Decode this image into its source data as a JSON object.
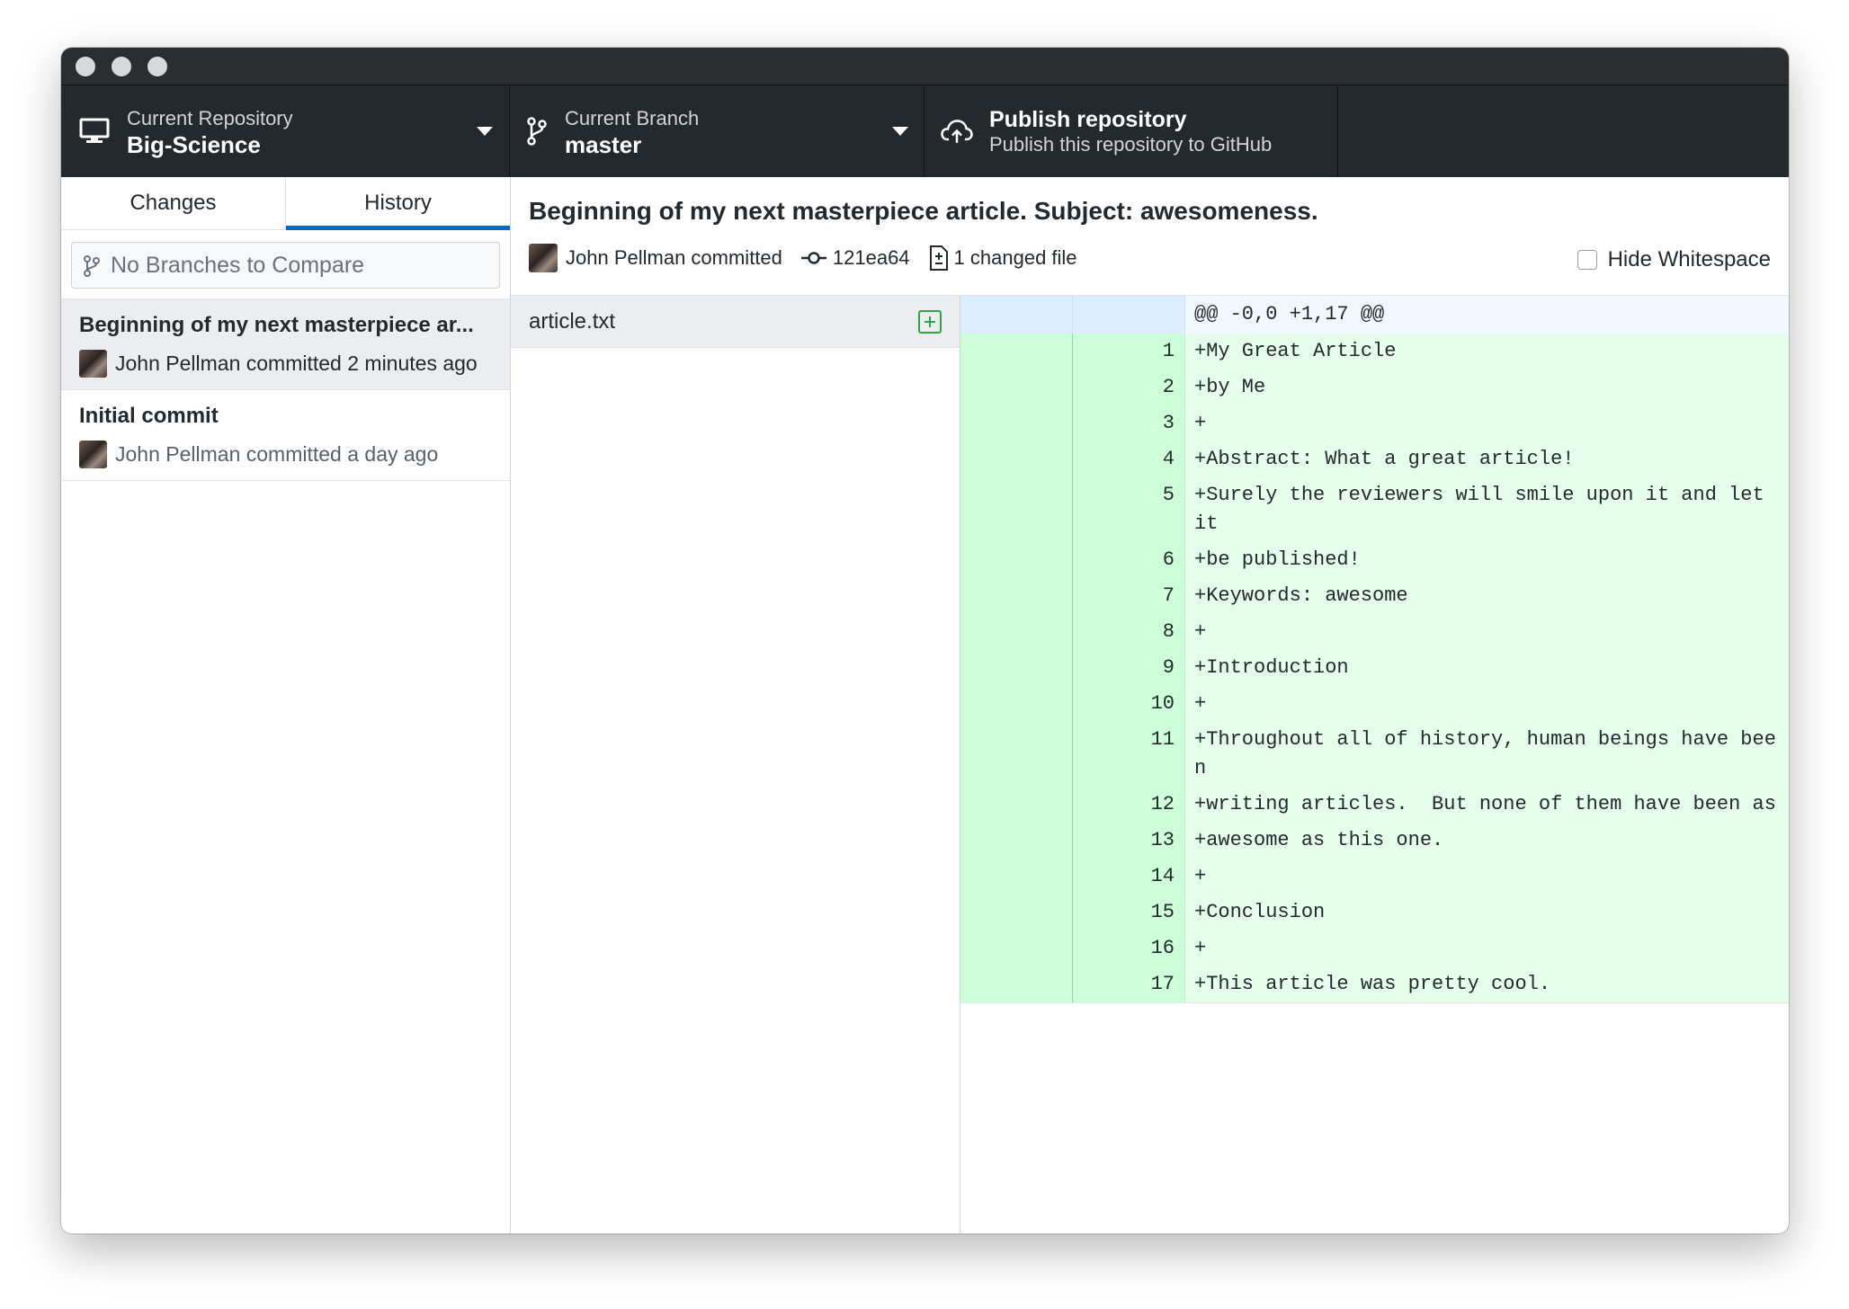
{
  "toolbar": {
    "repository": {
      "label": "Current Repository",
      "value": "Big-Science",
      "icon": "desktop-icon"
    },
    "branch": {
      "label": "Current Branch",
      "value": "master",
      "icon": "git-branch-icon"
    },
    "publish": {
      "title": "Publish repository",
      "subtitle": "Publish this repository to GitHub",
      "icon": "cloud-upload-icon"
    }
  },
  "sidebar": {
    "tabs": [
      {
        "label": "Changes"
      },
      {
        "label": "History",
        "active": true
      }
    ],
    "compare_placeholder": "No Branches to Compare",
    "commits": [
      {
        "title": "Beginning of my next masterpiece ar...",
        "meta": "John Pellman committed 2 minutes ago",
        "selected": true
      },
      {
        "title": "Initial commit",
        "meta": "John Pellman committed a day ago",
        "selected": false
      }
    ]
  },
  "commit": {
    "summary": "Beginning of my next masterpiece article. Subject: awesomeness.",
    "author": "John Pellman committed",
    "sha": "121ea64",
    "changed": "1 changed file",
    "hide_whitespace": "Hide Whitespace"
  },
  "files": [
    {
      "name": "article.txt",
      "status": "added"
    }
  ],
  "diff": {
    "hunk": "@@ -0,0 +1,17 @@",
    "lines": [
      {
        "n": "1",
        "text": "+My Great Article"
      },
      {
        "n": "2",
        "text": "+by Me"
      },
      {
        "n": "3",
        "text": "+"
      },
      {
        "n": "4",
        "text": "+Abstract: What a great article!"
      },
      {
        "n": "5",
        "text": "+Surely the reviewers will smile upon it and let it"
      },
      {
        "n": "6",
        "text": "+be published!"
      },
      {
        "n": "7",
        "text": "+Keywords: awesome"
      },
      {
        "n": "8",
        "text": "+"
      },
      {
        "n": "9",
        "text": "+Introduction"
      },
      {
        "n": "10",
        "text": "+"
      },
      {
        "n": "11",
        "text": "+Throughout all of history, human beings have been"
      },
      {
        "n": "12",
        "text": "+writing articles.  But none of them have been as"
      },
      {
        "n": "13",
        "text": "+awesome as this one."
      },
      {
        "n": "14",
        "text": "+"
      },
      {
        "n": "15",
        "text": "+Conclusion"
      },
      {
        "n": "16",
        "text": "+"
      },
      {
        "n": "17",
        "text": "+This article was pretty cool."
      }
    ]
  },
  "colors": {
    "toolbar_bg": "#24292e",
    "accent": "#0366d6",
    "added_bg": "#e6ffed",
    "added_gutter": "#cdffd8",
    "added_icon": "#28a745"
  }
}
